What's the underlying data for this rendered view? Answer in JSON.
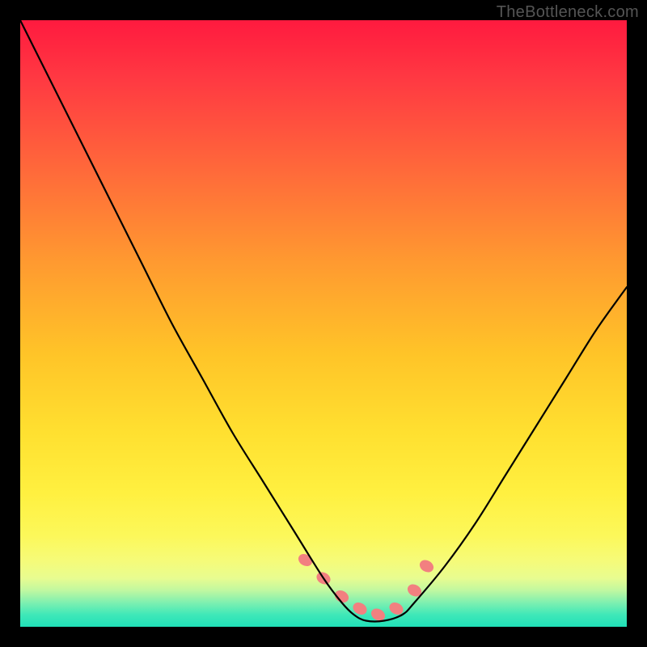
{
  "watermark": "TheBottleneck.com",
  "chart_data": {
    "type": "line",
    "title": "",
    "xlabel": "",
    "ylabel": "",
    "xlim": [
      0,
      100
    ],
    "ylim": [
      0,
      100
    ],
    "grid": false,
    "legend": false,
    "series": [
      {
        "name": "bottleneck-curve",
        "x": [
          0,
          5,
          10,
          15,
          20,
          25,
          30,
          35,
          40,
          45,
          50,
          53,
          55,
          57,
          60,
          63,
          65,
          70,
          75,
          80,
          85,
          90,
          95,
          100
        ],
        "values": [
          100,
          90,
          80,
          70,
          60,
          50,
          41,
          32,
          24,
          16,
          8,
          4,
          2,
          1,
          1,
          2,
          4,
          10,
          17,
          25,
          33,
          41,
          49,
          56
        ]
      }
    ],
    "markers": {
      "name": "highlight-points",
      "color": "#f28080",
      "x": [
        47,
        50,
        53,
        56,
        59,
        62,
        65,
        67
      ],
      "values": [
        11,
        8,
        5,
        3,
        2,
        3,
        6,
        10
      ]
    }
  }
}
